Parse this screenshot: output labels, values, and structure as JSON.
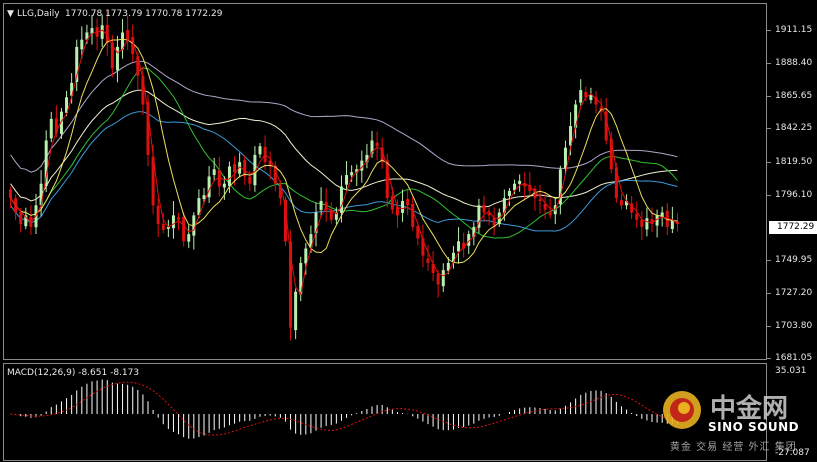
{
  "header": {
    "arrow": "▼",
    "symbol": "LLG,Daily",
    "ohlc": "1770.78 1773.79 1770.78 1772.29"
  },
  "price_axis": {
    "ticks": [
      "1911.15",
      "1888.40",
      "1865.65",
      "1842.25",
      "1819.50",
      "1796.10",
      "1749.95",
      "1727.20",
      "1703.80",
      "1681.05"
    ],
    "current_price": "1772.29"
  },
  "macd": {
    "label": "MACD(12,26,9) -8.651 -8.173",
    "top_tick": "35.031",
    "bottom_tick": "-27.087"
  },
  "watermark": {
    "cn_big": "中金网",
    "brand": "SINO SOUND",
    "cn_small": "黄金 交易 经营 外汇 集团"
  },
  "colors": {
    "up_candle": "#b8f0b0",
    "down_candle": "#e01010",
    "ma_fast": "#e8e060",
    "ma_red": "#e01010",
    "ma_green": "#30c030",
    "ma_blue": "#3a9ad8",
    "ma_white": "#f0f0d0",
    "ma_gray": "#b0a8c8",
    "signal": "#e01010"
  },
  "chart_data": {
    "type": "candlestick",
    "symbol": "LLG",
    "timeframe": "Daily",
    "ylim": [
      1681.05,
      1922
    ],
    "closes": [
      1790,
      1780,
      1772,
      1778,
      1770,
      1785,
      1800,
      1830,
      1845,
      1835,
      1850,
      1860,
      1870,
      1895,
      1900,
      1905,
      1908,
      1902,
      1910,
      1898,
      1880,
      1895,
      1905,
      1900,
      1890,
      1875,
      1855,
      1820,
      1785,
      1772,
      1768,
      1770,
      1778,
      1775,
      1760,
      1765,
      1778,
      1790,
      1792,
      1805,
      1810,
      1798,
      1800,
      1812,
      1808,
      1815,
      1805,
      1800,
      1820,
      1826,
      1815,
      1812,
      1800,
      1790,
      1760,
      1700,
      1725,
      1745,
      1755,
      1765,
      1780,
      1788,
      1782,
      1775,
      1780,
      1798,
      1806,
      1808,
      1810,
      1816,
      1820,
      1830,
      1826,
      1815,
      1790,
      1782,
      1778,
      1788,
      1785,
      1770,
      1762,
      1750,
      1745,
      1738,
      1730,
      1740,
      1745,
      1752,
      1760,
      1755,
      1765,
      1770,
      1785,
      1780,
      1778,
      1770,
      1780,
      1790,
      1795,
      1800,
      1802,
      1798,
      1795,
      1790,
      1788,
      1782,
      1778,
      1785,
      1810,
      1825,
      1840,
      1855,
      1865,
      1860,
      1862,
      1855,
      1850,
      1830,
      1810,
      1790,
      1785,
      1788,
      1780,
      1775,
      1770,
      1776,
      1772,
      1778,
      1780,
      1770,
      1775,
      1772
    ]
  }
}
